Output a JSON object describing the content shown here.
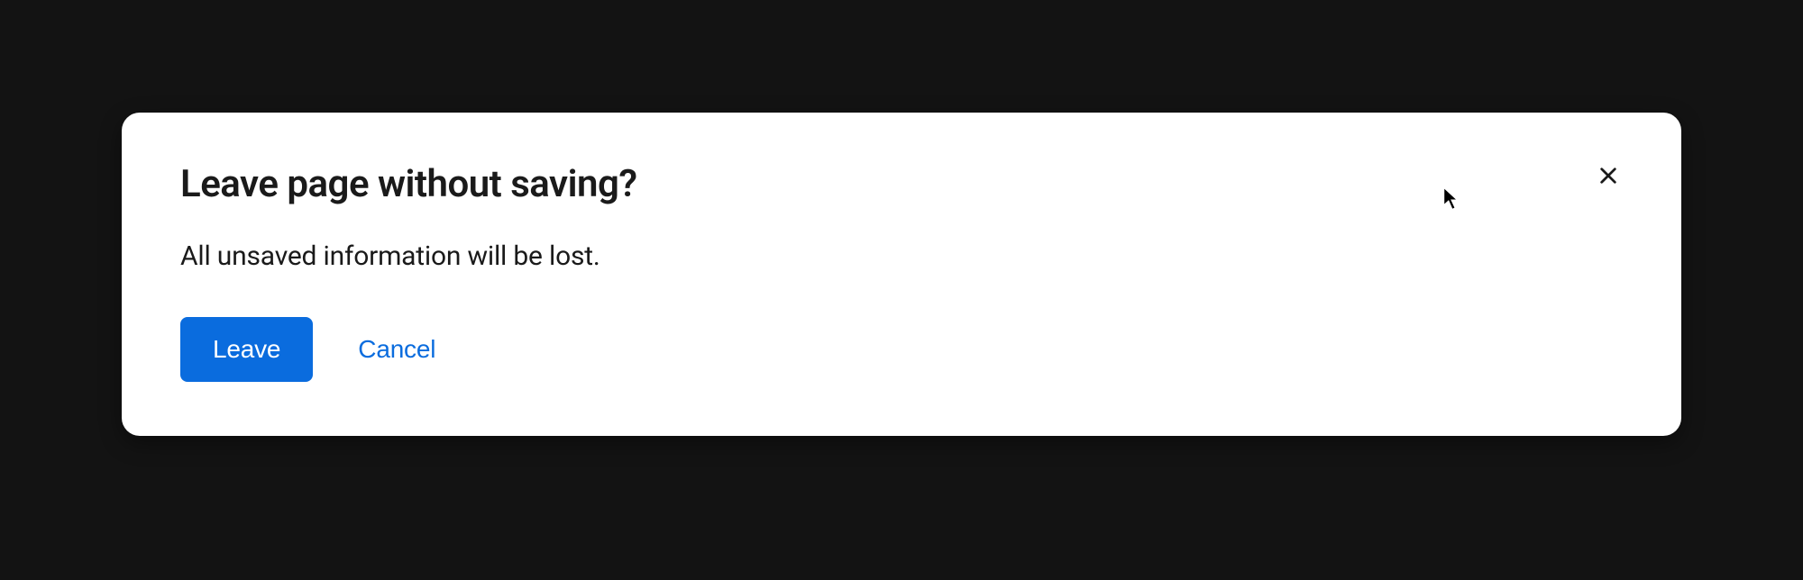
{
  "dialog": {
    "title": "Leave page without saving?",
    "message": "All unsaved information will be lost.",
    "primary_action_label": "Leave",
    "secondary_action_label": "Cancel"
  },
  "colors": {
    "background": "#131313",
    "dialog_bg": "#ffffff",
    "text": "#1a1a1a",
    "primary": "#0a6cde"
  }
}
